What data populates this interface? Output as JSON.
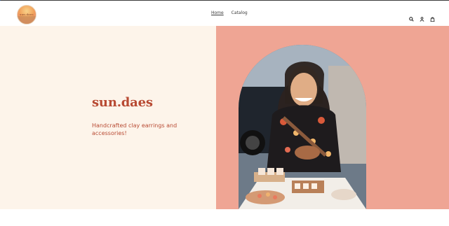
{
  "header": {
    "logo_text": "sun.daes",
    "nav": [
      {
        "label": "Home"
      },
      {
        "label": "Catalog"
      }
    ],
    "icons": [
      "search-icon",
      "account-icon",
      "cart-icon"
    ]
  },
  "hero": {
    "brand": "sun.daes",
    "tagline": "Handcrafted clay earrings and accessories!",
    "colors": {
      "left_bg": "#fdf4ea",
      "right_bg": "#efa594",
      "text": "#b84a33"
    }
  }
}
